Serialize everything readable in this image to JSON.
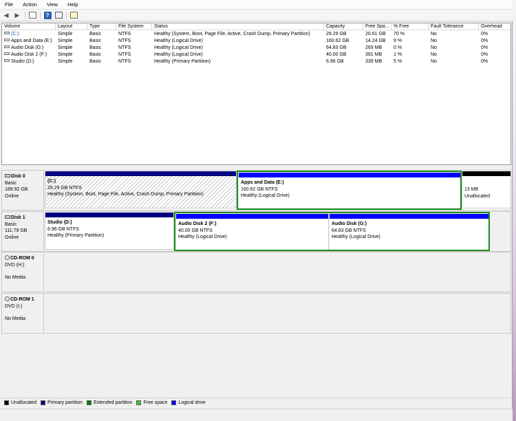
{
  "menu": [
    "File",
    "Action",
    "View",
    "Help"
  ],
  "toolbar": {
    "icons": [
      "back-arrow-icon",
      "forward-arrow-icon",
      "console-tree-icon",
      "properties-icon",
      "help-icon",
      "disk-settings-icon"
    ]
  },
  "volume_list": {
    "columns": [
      "Volume",
      "Layout",
      "Type",
      "File System",
      "Status",
      "Capacity",
      "Free Spa...",
      "% Free",
      "Fault Tolerance",
      "Overhead"
    ],
    "rows": [
      [
        "(C:)",
        "Simple",
        "Basic",
        "NTFS",
        "Healthy (System, Boot, Page File, Active, Crash Dump, Primary Partition)",
        "29.29 GB",
        "20.61 GB",
        "70 %",
        "No",
        "0%"
      ],
      [
        "Apps and Data (E:)",
        "Simple",
        "Basic",
        "NTFS",
        "Healthy (Logical Drive)",
        "160.62 GB",
        "14.24 GB",
        "9 %",
        "No",
        "0%"
      ],
      [
        "Audio Disk (G:)",
        "Simple",
        "Basic",
        "NTFS",
        "Healthy (Logical Drive)",
        "64.83 GB",
        "269 MB",
        "0 %",
        "No",
        "0%"
      ],
      [
        "Audio Disk 2 (F:)",
        "Simple",
        "Basic",
        "NTFS",
        "Healthy (Logical Drive)",
        "40.00 GB",
        "391 MB",
        "1 %",
        "No",
        "0%"
      ],
      [
        "Studio (D:)",
        "Simple",
        "Basic",
        "NTFS",
        "Healthy (Primary Partition)",
        "6.96 GB",
        "339 MB",
        "5 %",
        "No",
        "0%"
      ]
    ]
  },
  "disks": [
    {
      "name": "Disk 0",
      "type": "Basic",
      "size": "189.92 GB",
      "status": "Online",
      "partitions": [
        {
          "name": "(C:)",
          "size": "29.29 GB NTFS",
          "status": "Healthy (System, Boot, Page File, Active, Crash Dump, Primary Partition)"
        },
        {
          "name": "Apps and Data  (E:)",
          "size": "160.62 GB NTFS",
          "status": "Healthy (Logical Drive)"
        },
        {
          "size": "13 MB",
          "status": "Unallocated"
        }
      ]
    },
    {
      "name": "Disk 1",
      "type": "Basic",
      "size": "111.79 GB",
      "status": "Online",
      "partitions": [
        {
          "name": "Studio  (D:)",
          "size": "6.96 GB NTFS",
          "status": "Healthy (Primary Partition)"
        },
        {
          "name": "Audio Disk 2  (F:)",
          "size": "40.00 GB NTFS",
          "status": "Healthy (Logical Drive)"
        },
        {
          "name": "Audio Disk  (G:)",
          "size": "64.83 GB NTFS",
          "status": "Healthy (Logical Drive)"
        }
      ]
    },
    {
      "name": "CD-ROM 0",
      "type": "DVD (H:)",
      "status": "No Media"
    },
    {
      "name": "CD-ROM 1",
      "type": "DVD (I:)",
      "status": "No Media"
    }
  ],
  "legend": [
    {
      "label": "Unallocated",
      "color": "#000000"
    },
    {
      "label": "Primary partition",
      "color": "#000080"
    },
    {
      "label": "Extended partition",
      "color": "#008000"
    },
    {
      "label": "Free space",
      "color": "#33cc33"
    },
    {
      "label": "Logical drive",
      "color": "#0000ff"
    }
  ],
  "colors": {
    "primary": "#000080",
    "logical": "#0000ff",
    "extended": "#1a8a1a",
    "unallocated": "#000000"
  }
}
